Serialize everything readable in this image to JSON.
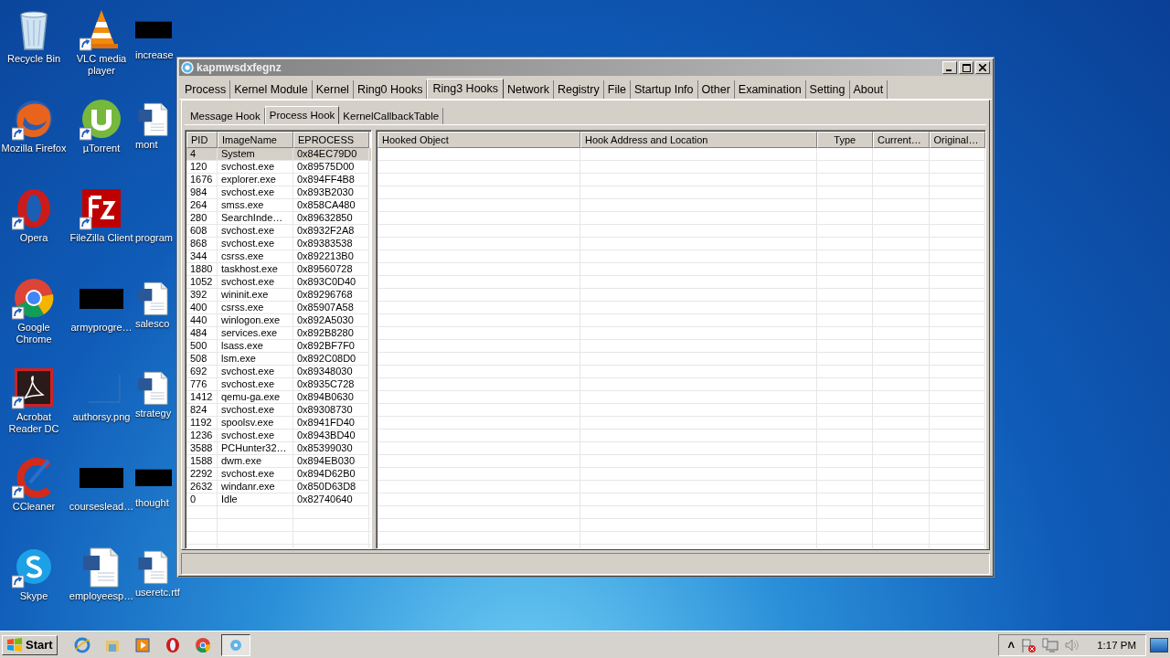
{
  "desktop": {
    "icons": [
      {
        "label": "Recycle Bin",
        "kind": "recycle",
        "shortcut": false
      },
      {
        "label": "Mozilla Firefox",
        "kind": "firefox",
        "shortcut": true
      },
      {
        "label": "Opera",
        "kind": "opera",
        "shortcut": true
      },
      {
        "label": "Google Chrome",
        "kind": "chrome",
        "shortcut": true
      },
      {
        "label": "Acrobat Reader DC",
        "kind": "acrobat",
        "shortcut": true
      },
      {
        "label": "CCleaner",
        "kind": "ccleaner",
        "shortcut": true
      },
      {
        "label": "Skype",
        "kind": "skype",
        "shortcut": true
      },
      {
        "label": "VLC media player",
        "kind": "vlc",
        "shortcut": true
      },
      {
        "label": "µTorrent",
        "kind": "utorrent",
        "shortcut": true
      },
      {
        "label": "FileZilla Client",
        "kind": "filezilla",
        "shortcut": true
      },
      {
        "label": "armyprogre…",
        "kind": "redacted",
        "shortcut": false
      },
      {
        "label": "authorsy.png",
        "kind": "image",
        "shortcut": false
      },
      {
        "label": "courseslead…",
        "kind": "redacted",
        "shortcut": false
      },
      {
        "label": "employeesp…",
        "kind": "word",
        "shortcut": false
      },
      {
        "label": "increase",
        "kind": "redacted",
        "shortcut": false
      },
      {
        "label": "mont",
        "kind": "word",
        "shortcut": false
      },
      {
        "label": "program",
        "kind": "none"
      },
      {
        "label": "salesco",
        "kind": "word",
        "shortcut": false
      },
      {
        "label": "strategy",
        "kind": "word",
        "shortcut": false
      },
      {
        "label": "thought",
        "kind": "redacted",
        "shortcut": false
      },
      {
        "label": "useretc.rtf",
        "kind": "word",
        "shortcut": false
      }
    ]
  },
  "window": {
    "title": "kapmwsdxfegnz",
    "tabs": [
      {
        "label": "Process",
        "selected": false
      },
      {
        "label": "Kernel Module",
        "selected": false
      },
      {
        "label": "Kernel",
        "selected": false
      },
      {
        "label": "Ring0 Hooks",
        "selected": false
      },
      {
        "label": "Ring3 Hooks",
        "selected": true
      },
      {
        "label": "Network",
        "selected": false
      },
      {
        "label": "Registry",
        "selected": false
      },
      {
        "label": "File",
        "selected": false
      },
      {
        "label": "Startup Info",
        "selected": false
      },
      {
        "label": "Other",
        "selected": false
      },
      {
        "label": "Examination",
        "selected": false
      },
      {
        "label": "Setting",
        "selected": false
      },
      {
        "label": "About",
        "selected": false
      }
    ],
    "subtabs": [
      {
        "label": "Message Hook",
        "selected": false
      },
      {
        "label": "Process Hook",
        "selected": true
      },
      {
        "label": "KernelCallbackTable",
        "selected": false
      }
    ],
    "process_table": {
      "columns": [
        "PID",
        "ImageName",
        "EPROCESS"
      ],
      "rows": [
        {
          "pid": "4",
          "image": "System",
          "eprocess": "0x84EC79D0",
          "selected": true
        },
        {
          "pid": "120",
          "image": "svchost.exe",
          "eprocess": "0x89575D00",
          "selected": false
        },
        {
          "pid": "1676",
          "image": "explorer.exe",
          "eprocess": "0x894FF4B8",
          "selected": false
        },
        {
          "pid": "984",
          "image": "svchost.exe",
          "eprocess": "0x893B2030",
          "selected": false
        },
        {
          "pid": "264",
          "image": "smss.exe",
          "eprocess": "0x858CA480",
          "selected": false
        },
        {
          "pid": "280",
          "image": "SearchInde…",
          "eprocess": "0x89632850",
          "selected": false
        },
        {
          "pid": "608",
          "image": "svchost.exe",
          "eprocess": "0x8932F2A8",
          "selected": false
        },
        {
          "pid": "868",
          "image": "svchost.exe",
          "eprocess": "0x89383538",
          "selected": false
        },
        {
          "pid": "344",
          "image": "csrss.exe",
          "eprocess": "0x892213B0",
          "selected": false
        },
        {
          "pid": "1880",
          "image": "taskhost.exe",
          "eprocess": "0x89560728",
          "selected": false
        },
        {
          "pid": "1052",
          "image": "svchost.exe",
          "eprocess": "0x893C0D40",
          "selected": false
        },
        {
          "pid": "392",
          "image": "wininit.exe",
          "eprocess": "0x89296768",
          "selected": false
        },
        {
          "pid": "400",
          "image": "csrss.exe",
          "eprocess": "0x85907A58",
          "selected": false
        },
        {
          "pid": "440",
          "image": "winlogon.exe",
          "eprocess": "0x892A5030",
          "selected": false
        },
        {
          "pid": "484",
          "image": "services.exe",
          "eprocess": "0x892B8280",
          "selected": false
        },
        {
          "pid": "500",
          "image": "lsass.exe",
          "eprocess": "0x892BF7F0",
          "selected": false
        },
        {
          "pid": "508",
          "image": "lsm.exe",
          "eprocess": "0x892C08D0",
          "selected": false
        },
        {
          "pid": "692",
          "image": "svchost.exe",
          "eprocess": "0x89348030",
          "selected": false
        },
        {
          "pid": "776",
          "image": "svchost.exe",
          "eprocess": "0x8935C728",
          "selected": false
        },
        {
          "pid": "1412",
          "image": "qemu-ga.exe",
          "eprocess": "0x894B0630",
          "selected": false
        },
        {
          "pid": "824",
          "image": "svchost.exe",
          "eprocess": "0x89308730",
          "selected": false
        },
        {
          "pid": "1192",
          "image": "spoolsv.exe",
          "eprocess": "0x8941FD40",
          "selected": false
        },
        {
          "pid": "1236",
          "image": "svchost.exe",
          "eprocess": "0x8943BD40",
          "selected": false
        },
        {
          "pid": "3588",
          "image": "PCHunter32…",
          "eprocess": "0x85399030",
          "selected": false
        },
        {
          "pid": "1588",
          "image": "dwm.exe",
          "eprocess": "0x894EB030",
          "selected": false
        },
        {
          "pid": "2292",
          "image": "svchost.exe",
          "eprocess": "0x894D62B0",
          "selected": false
        },
        {
          "pid": "2632",
          "image": "windanr.exe",
          "eprocess": "0x850D63D8",
          "selected": false
        },
        {
          "pid": "0",
          "image": "Idle",
          "eprocess": "0x82740640",
          "selected": false
        }
      ]
    },
    "hook_table": {
      "columns": [
        "Hooked Object",
        "Hook Address and Location",
        "Type",
        "Current…",
        "Original…"
      ]
    }
  },
  "taskbar": {
    "start": "Start",
    "apps": [
      {
        "kind": "ie",
        "active": false
      },
      {
        "kind": "folder",
        "active": false
      },
      {
        "kind": "media",
        "active": false
      },
      {
        "kind": "opera",
        "active": false
      },
      {
        "kind": "chrome",
        "active": false
      },
      {
        "kind": "app",
        "active": true
      }
    ],
    "tray": {
      "expand": "˄",
      "time": "1:17 PM"
    }
  }
}
